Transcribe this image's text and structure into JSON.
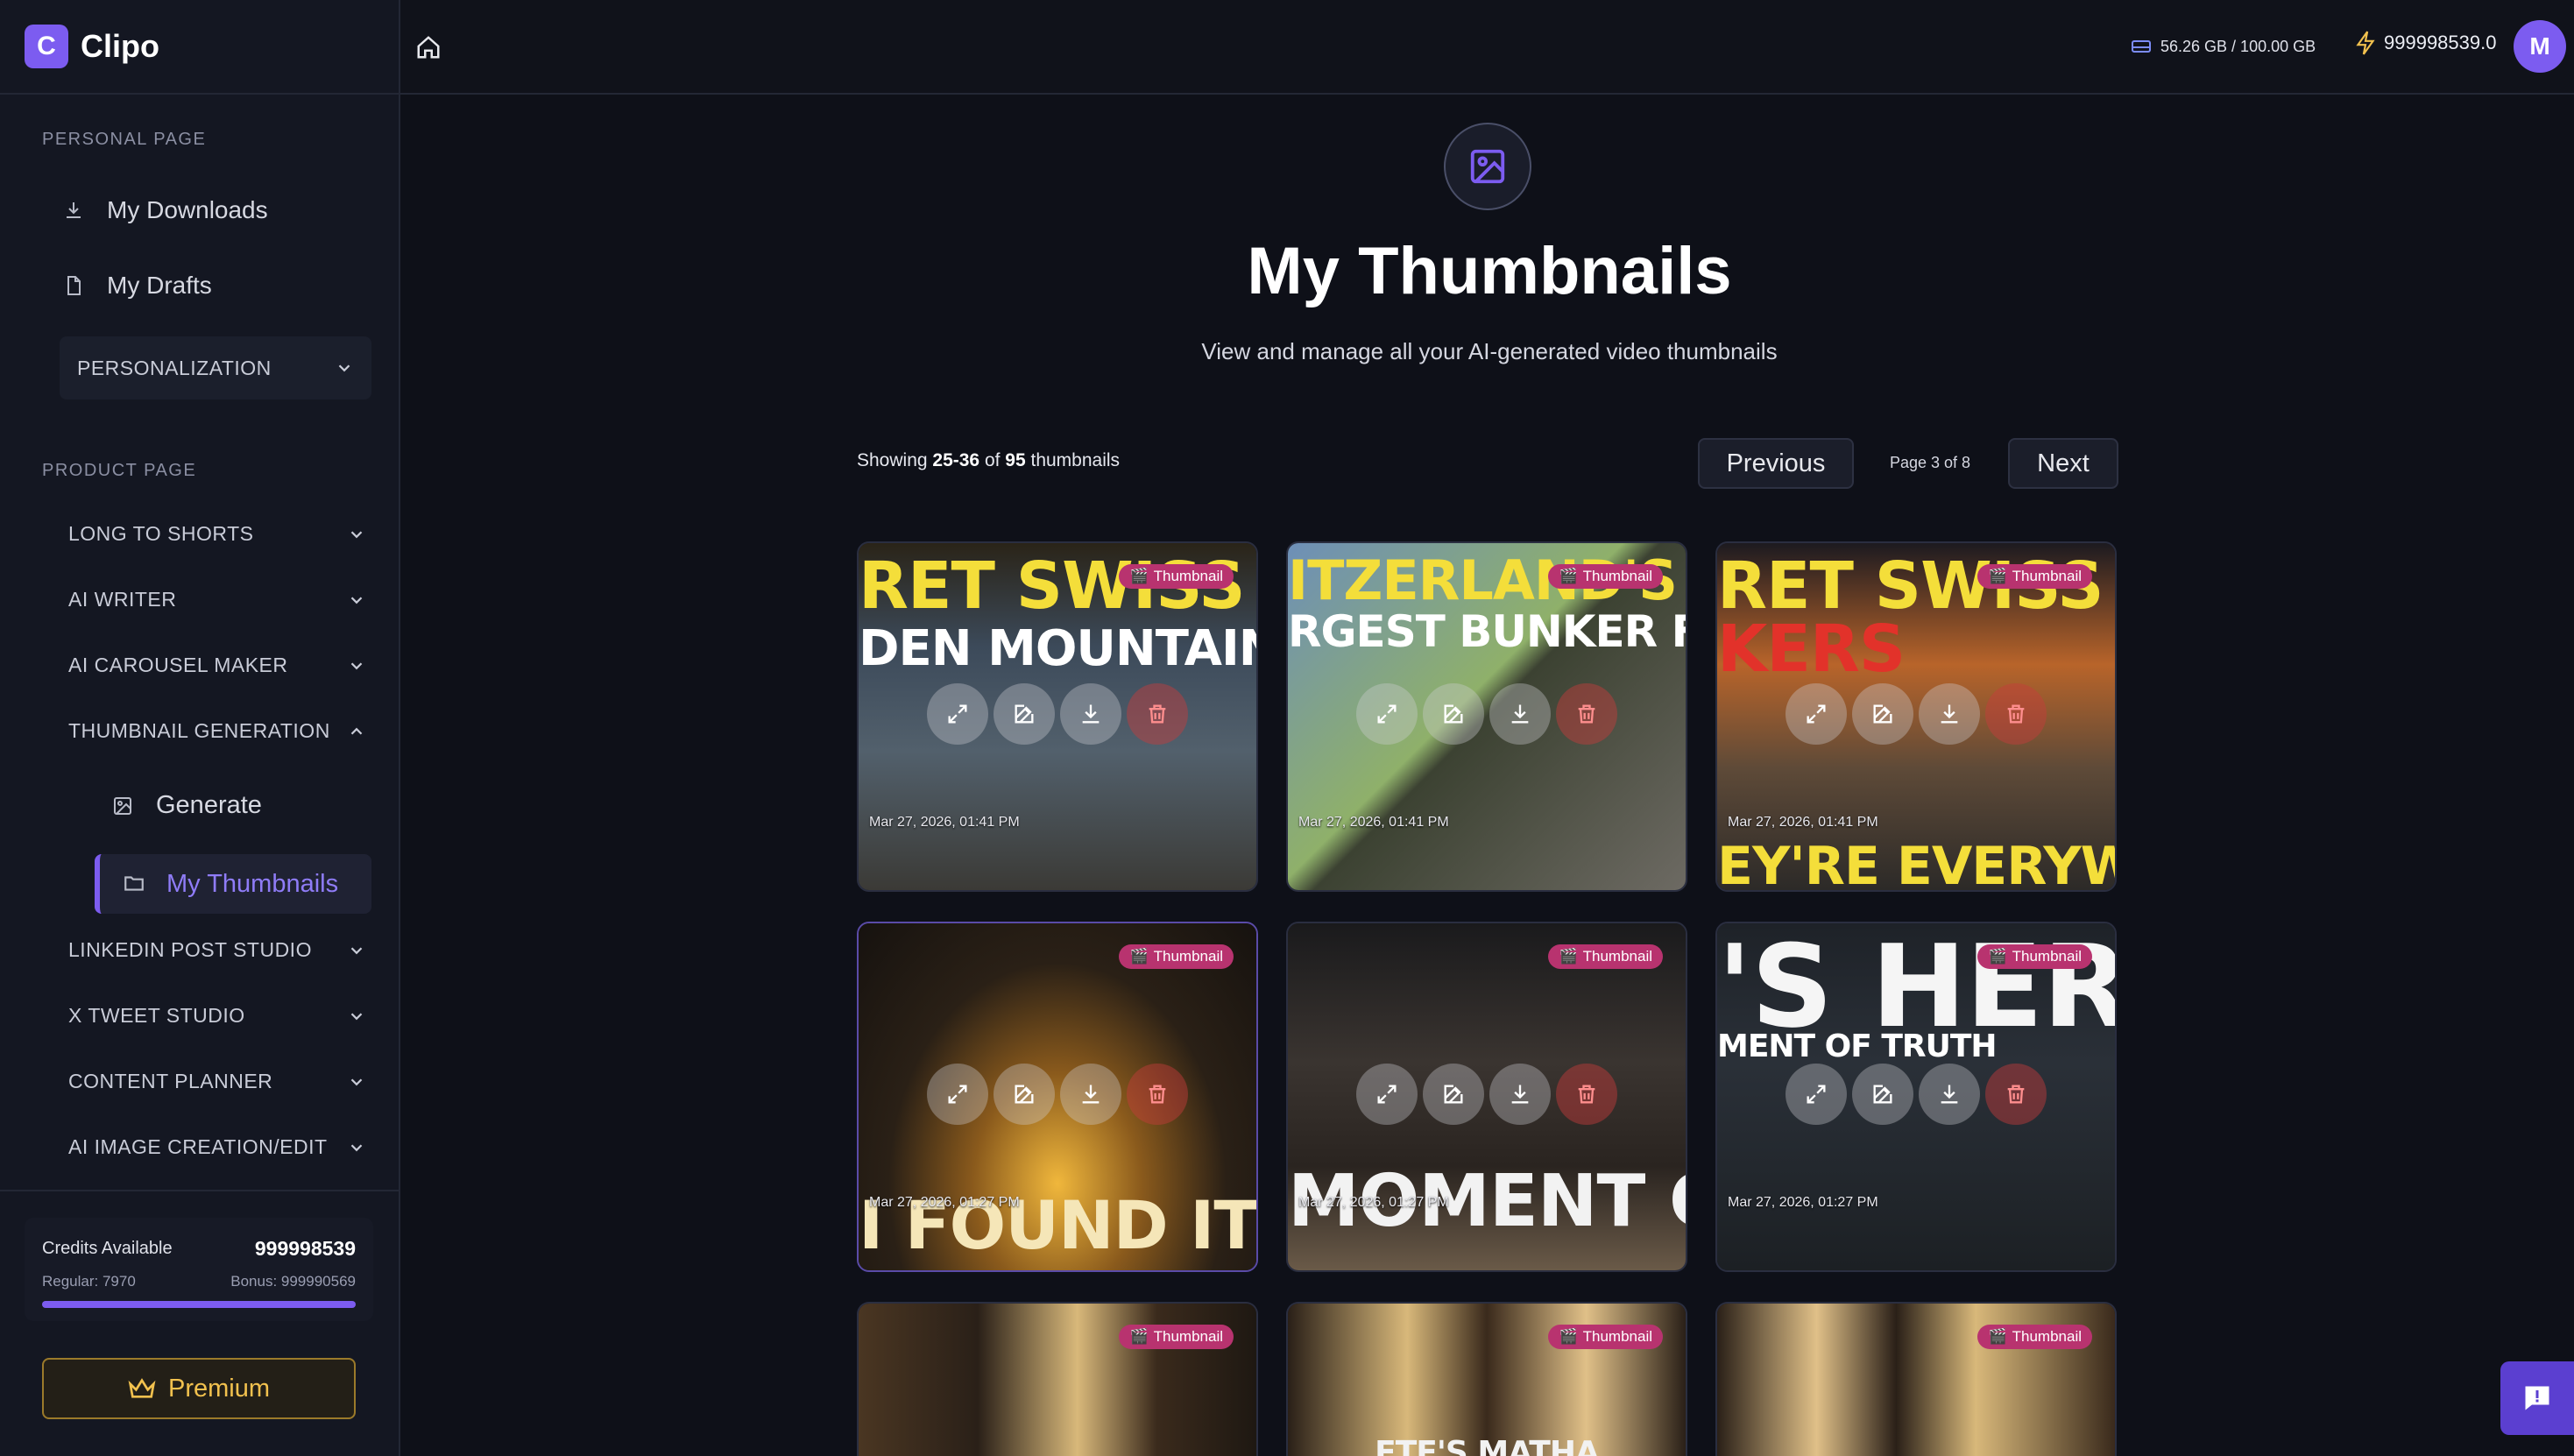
{
  "app": {
    "logo_letter": "C",
    "name": "Clipo"
  },
  "topbar": {
    "storage": "56.26 GB / 100.00 GB",
    "credits": "999998539.0",
    "avatar_letter": "M"
  },
  "sidebar": {
    "personal_title": "PERSONAL PAGE",
    "personal_items": [
      "My Downloads",
      "My Drafts"
    ],
    "personalization": "PERSONALIZATION",
    "product_title": "PRODUCT PAGE",
    "groups": {
      "long_to_shorts": "LONG TO SHORTS",
      "ai_writer": "AI WRITER",
      "ai_carousel": "AI CAROUSEL MAKER",
      "thumbnail_generation": "THUMBNAIL GENERATION",
      "linkedin": "LINKEDIN POST STUDIO",
      "x_tweet": "X TWEET STUDIO",
      "content_planner": "CONTENT PLANNER",
      "ai_image": "AI IMAGE CREATION/EDIT"
    },
    "thumb_sub": {
      "generate": "Generate",
      "my_thumbnails": "My Thumbnails"
    },
    "credits": {
      "label": "Credits Available",
      "value": "999998539",
      "regular": "Regular: 7970",
      "bonus": "Bonus: 999990569",
      "fill_fraction": 1.0
    },
    "premium": "Premium"
  },
  "main": {
    "title": "My Thumbnails",
    "subtitle": "View and manage all your AI-generated video thumbnails",
    "showing_prefix": "Showing ",
    "showing_range": "25-36",
    "showing_of": " of ",
    "showing_total": "95",
    "showing_suffix": " thumbnails",
    "previous": "Previous",
    "page_indicator": "Page 3 of 8",
    "next": "Next"
  },
  "badge_label": "Thumbnail",
  "cards": [
    {
      "line1": "RET SWISS BUNKI",
      "line2": "DEN MOUNTAIN FORTRE",
      "date": "Mar 27, 2026, 01:41 PM"
    },
    {
      "line1": "ITZERLAND'S SECI",
      "line2": "RGEST BUNKER FOUND",
      "date": "Mar 27, 2026, 01:41 PM"
    },
    {
      "line1": "RET SWISS",
      "line2": "KERS",
      "line3": "EY'RE EVERYWHE",
      "date": "Mar 27, 2026, 01:41 PM"
    },
    {
      "line1": "I FOUND IT",
      "date": "Mar 27, 2026, 01:27 PM"
    },
    {
      "line1": "MOMENT OF TRU",
      "date": "Mar 27, 2026, 01:27 PM"
    },
    {
      "line1": "'S HER",
      "line2": "MENT OF TRUTH",
      "date": "Mar 27, 2026, 01:27 PM"
    },
    {
      "line1": ""
    },
    {
      "line1": "ETF'S MATHA"
    },
    {
      "line1": ""
    }
  ],
  "colors": {
    "accent": "#7c5cf0",
    "badge": "#b8336f",
    "background": "#0e1018",
    "premium": "#f2c14e"
  }
}
